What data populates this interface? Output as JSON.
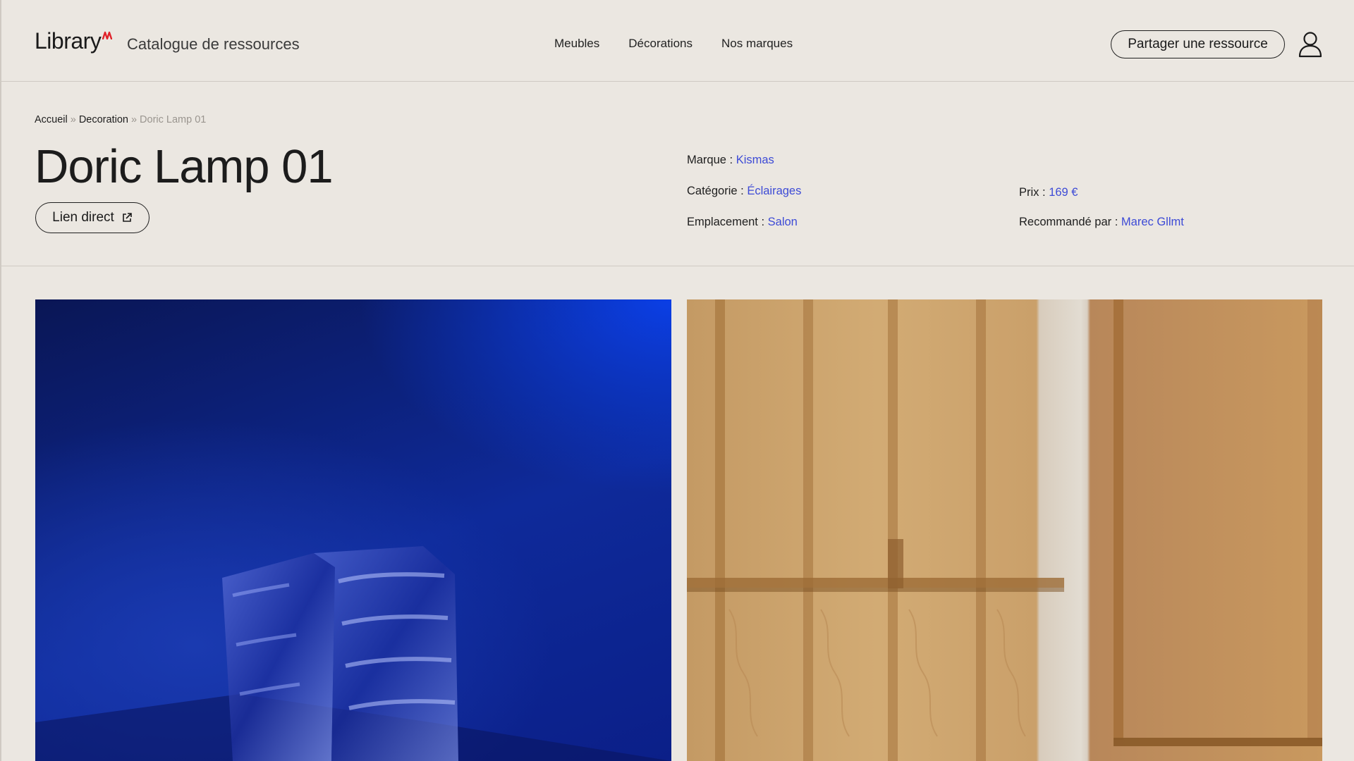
{
  "header": {
    "logo": "Library",
    "tagline": "Catalogue de ressources",
    "nav": [
      "Meubles",
      "Décorations",
      "Nos marques"
    ],
    "share_button": "Partager une ressource",
    "user_icon": "user-icon"
  },
  "breadcrumb": {
    "home": "Accueil",
    "separator": "»",
    "category": "Decoration",
    "current": "Doric Lamp 01"
  },
  "product": {
    "title": "Doric Lamp 01",
    "direct_link": "Lien direct",
    "brand_label": "Marque :",
    "brand": "Kismas",
    "category_label": "Catégorie :",
    "category": "Éclairages",
    "location_label": "Emplacement :",
    "location": "Salon",
    "price_label": "Prix :",
    "price": "169 €",
    "recommended_label": "Recommandé par :",
    "recommended_by": "Marec Gllmt"
  },
  "colors": {
    "background": "#ebe7e1",
    "link": "#3d4bd6",
    "logo_accent": "#e0222a"
  }
}
